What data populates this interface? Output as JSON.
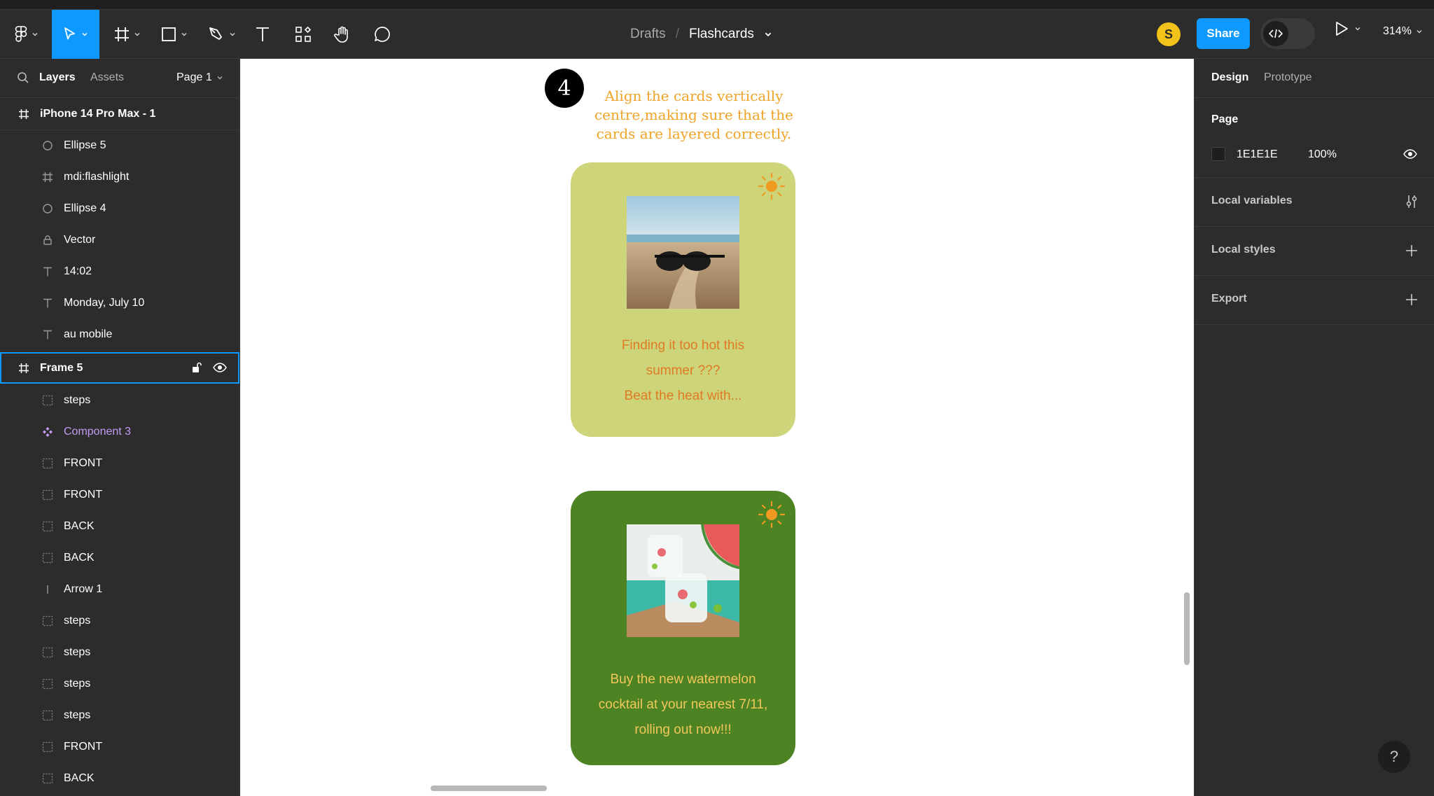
{
  "breadcrumb": {
    "drafts": "Drafts",
    "separator": "/",
    "file": "Flashcards"
  },
  "user": {
    "initial": "S"
  },
  "toolbar": {
    "share_label": "Share",
    "zoom": "314%"
  },
  "left_panel": {
    "tab_layers": "Layers",
    "tab_assets": "Assets",
    "page_selector": "Page 1",
    "top_frame": "iPhone 14 Pro Max - 1",
    "layers": [
      {
        "label": "Ellipse 5",
        "icon": "ellipse-icon"
      },
      {
        "label": "mdi:flashlight",
        "icon": "frame-icon"
      },
      {
        "label": "Ellipse 4",
        "icon": "ellipse-icon"
      },
      {
        "label": "Vector",
        "icon": "vector-icon"
      },
      {
        "label": "14:02",
        "icon": "text-icon"
      },
      {
        "label": "Monday, July 10",
        "icon": "text-icon"
      },
      {
        "label": "au mobile",
        "icon": "text-icon"
      }
    ],
    "selected_frame": "Frame 5",
    "children": [
      {
        "label": "steps",
        "icon": "section-icon"
      },
      {
        "label": "Component 3",
        "icon": "component-icon"
      },
      {
        "label": "FRONT",
        "icon": "section-icon"
      },
      {
        "label": "FRONT",
        "icon": "section-icon"
      },
      {
        "label": "BACK",
        "icon": "section-icon"
      },
      {
        "label": "BACK",
        "icon": "section-icon"
      },
      {
        "label": "Arrow 1",
        "icon": "line-icon"
      },
      {
        "label": "steps",
        "icon": "section-icon"
      },
      {
        "label": "steps",
        "icon": "section-icon"
      },
      {
        "label": "steps",
        "icon": "section-icon"
      },
      {
        "label": "steps",
        "icon": "section-icon"
      },
      {
        "label": "FRONT",
        "icon": "section-icon"
      },
      {
        "label": "BACK",
        "icon": "section-icon"
      }
    ]
  },
  "canvas": {
    "step_number": "4",
    "step_text": "Align the cards vertically centre,making sure that the cards are layered correctly.",
    "card1": {
      "color": "#cdd47a",
      "line1": "Finding it too hot this",
      "line2": "summer ???",
      "line3": "Beat the heat with..."
    },
    "card2": {
      "color": "#4e8323",
      "line1": "Buy the new watermelon",
      "line2": "cocktail at your nearest 7/11,",
      "line3": "rolling out now!!!"
    }
  },
  "right_panel": {
    "tab_design": "Design",
    "tab_prototype": "Prototype",
    "page_title": "Page",
    "page_color_hex": "1E1E1E",
    "page_opacity": "100%",
    "local_variables": "Local variables",
    "local_styles": "Local styles",
    "export": "Export"
  },
  "help": "?"
}
